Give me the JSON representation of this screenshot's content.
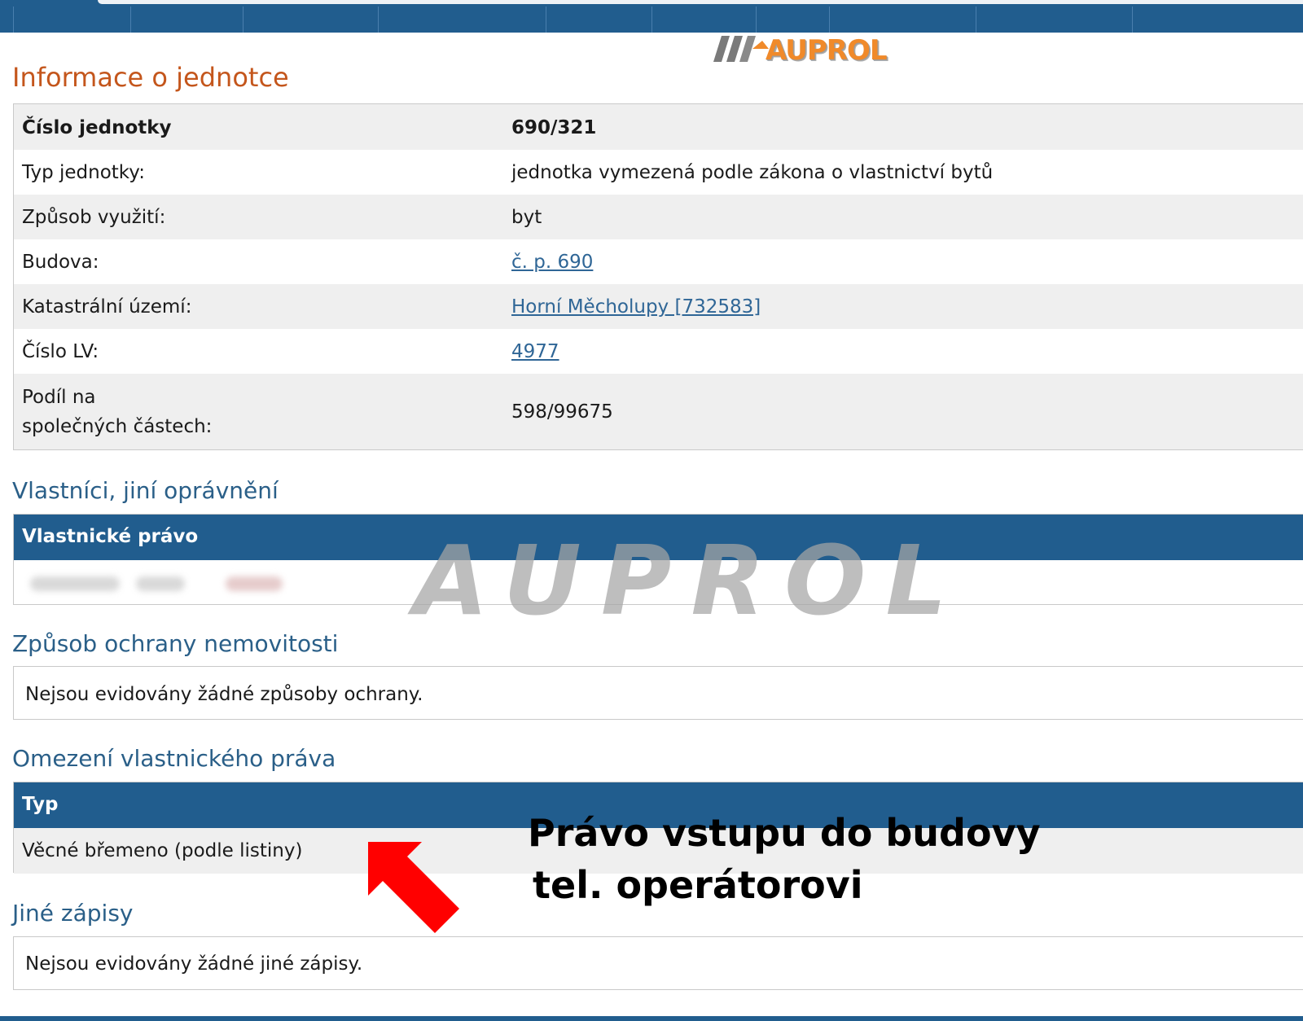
{
  "colors": {
    "nav_blue": "#215d8e",
    "heading_orange": "#c4561c",
    "heading_blue": "#2a5f88",
    "link_blue": "#2f6696",
    "row_gray": "#efefef",
    "arrow_red": "#ff0000",
    "logo_orange": "#f08a2a"
  },
  "logo": {
    "text": "AUPROL",
    "icon": "auprol-logo-icon"
  },
  "watermark": "AUPROL",
  "unit_info": {
    "title": "Informace o jednotce",
    "rows": [
      {
        "label": "Číslo jednotky",
        "value": "690/321"
      },
      {
        "label": "Typ jednotky:",
        "value": "jednotka vymezená podle zákona o vlastnictví bytů"
      },
      {
        "label": "Způsob využití:",
        "value": "byt"
      },
      {
        "label": "Budova:",
        "value": "č. p. 690"
      },
      {
        "label": "Katastrální území:",
        "value": "Horní Měcholupy [732583]"
      },
      {
        "label": "Číslo LV:",
        "value": "4977"
      },
      {
        "label_line1": "Podíl na",
        "label_line2": "společných částech:",
        "value": "598/99675"
      }
    ]
  },
  "owners": {
    "title": "Vlastníci, jiní oprávnění",
    "header": "Vlastnické právo"
  },
  "protection": {
    "title": "Způsob ochrany nemovitosti",
    "text": "Nejsou evidovány žádné způsoby ochrany."
  },
  "restrictions": {
    "title": "Omezení vlastnického práva",
    "header": "Typ",
    "row": "Věcné břemeno (podle listiny)"
  },
  "other_records": {
    "title": "Jiné zápisy",
    "text": "Nejsou evidovány žádné jiné zápisy."
  },
  "annotation": {
    "line1": "Právo vstupu do budovy",
    "line2": "tel. operátorovi",
    "icon": "red-arrow-icon"
  }
}
